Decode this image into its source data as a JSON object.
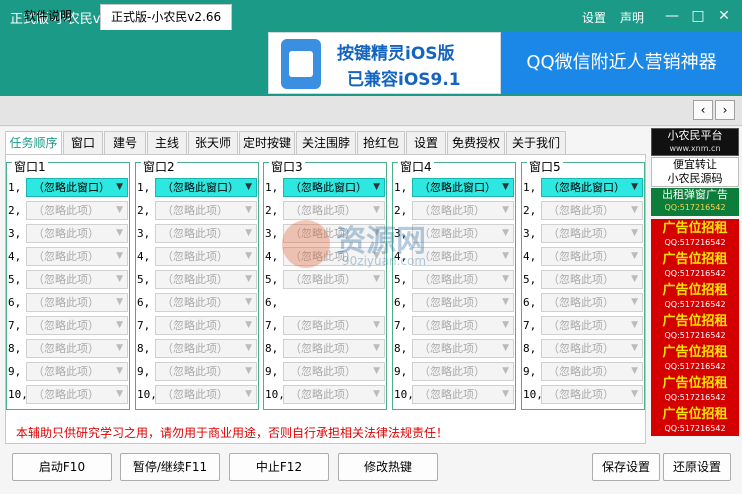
{
  "titlebar": {
    "title": "正式版-小农民v2.66",
    "settings_label": "设置",
    "statement_label": "声明"
  },
  "banner": {
    "ad1_line1": "按键精灵iOS版",
    "ad1_line2": "已兼容iOS9.1",
    "ad2_text": "QQ微信附近人营销神器"
  },
  "file_tabs": [
    {
      "label": "软件说明"
    },
    {
      "label": "正式版-小农民v2.66"
    }
  ],
  "sub_tabs": [
    {
      "label": "任务顺序"
    },
    {
      "label": "窗口"
    },
    {
      "label": "建号"
    },
    {
      "label": "主线"
    },
    {
      "label": "张天师"
    },
    {
      "label": "定时按键"
    },
    {
      "label": "关注围脖"
    },
    {
      "label": "抢红包"
    },
    {
      "label": "设置"
    },
    {
      "label": "免费授权"
    },
    {
      "label": "关于我们"
    }
  ],
  "row_labels": [
    "1,",
    "2,",
    "3,",
    "4,",
    "5,",
    "6,",
    "7,",
    "8,",
    "9,",
    "10,"
  ],
  "selected_value": "（忽略此窗口）",
  "ignore_value": "（忽略此项）",
  "groups": [
    {
      "title": "窗口1"
    },
    {
      "title": "窗口2"
    },
    {
      "title": "窗口3"
    },
    {
      "title": "窗口4"
    },
    {
      "title": "窗口5"
    }
  ],
  "disclaimer": "本辅助只供研究学习之用，请勿用于商业用途，否则自行承担相关法律法规责任！",
  "sidebar": {
    "platform_title": "小农民平台",
    "platform_url": "www.xnm.cn",
    "resell_line1": "便宜转让",
    "resell_line2": "小农民源码",
    "rent_line1": "出租弹窗广告",
    "rent_qq": "QQ:517216542",
    "ad_label": "广告位招租",
    "ad_qq": "QQ:517216542"
  },
  "watermark": {
    "text1": "资源网",
    "text2": "90ziyuan.com"
  },
  "buttons": {
    "start": "启动F10",
    "pause": "暂停/继续F11",
    "stop": "中止F12",
    "hotkey": "修改热键",
    "save": "保存设置",
    "restore": "还原设置"
  },
  "colors": {
    "titlebar": "#1a9a87",
    "selected_combo": "#2ce8e0",
    "group_border": "#4caf8a",
    "ad_tile": "#d40000",
    "disclaimer": "#e00000"
  }
}
